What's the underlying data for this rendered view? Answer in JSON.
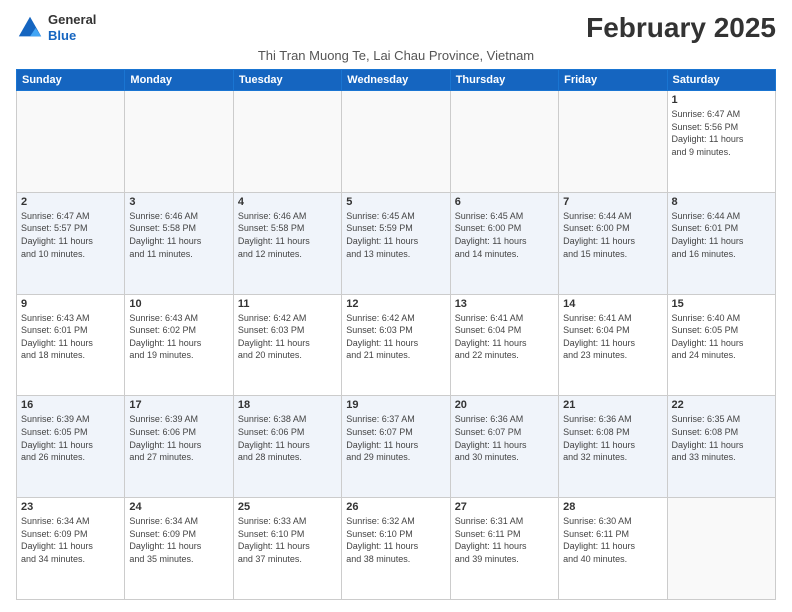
{
  "header": {
    "logo": {
      "general": "General",
      "blue": "Blue"
    },
    "title": "February 2025",
    "subtitle": "Thi Tran Muong Te, Lai Chau Province, Vietnam"
  },
  "days_of_week": [
    "Sunday",
    "Monday",
    "Tuesday",
    "Wednesday",
    "Thursday",
    "Friday",
    "Saturday"
  ],
  "weeks": [
    [
      {
        "day": "",
        "info": ""
      },
      {
        "day": "",
        "info": ""
      },
      {
        "day": "",
        "info": ""
      },
      {
        "day": "",
        "info": ""
      },
      {
        "day": "",
        "info": ""
      },
      {
        "day": "",
        "info": ""
      },
      {
        "day": "1",
        "info": "Sunrise: 6:47 AM\nSunset: 5:56 PM\nDaylight: 11 hours\nand 9 minutes."
      }
    ],
    [
      {
        "day": "2",
        "info": "Sunrise: 6:47 AM\nSunset: 5:57 PM\nDaylight: 11 hours\nand 10 minutes."
      },
      {
        "day": "3",
        "info": "Sunrise: 6:46 AM\nSunset: 5:58 PM\nDaylight: 11 hours\nand 11 minutes."
      },
      {
        "day": "4",
        "info": "Sunrise: 6:46 AM\nSunset: 5:58 PM\nDaylight: 11 hours\nand 12 minutes."
      },
      {
        "day": "5",
        "info": "Sunrise: 6:45 AM\nSunset: 5:59 PM\nDaylight: 11 hours\nand 13 minutes."
      },
      {
        "day": "6",
        "info": "Sunrise: 6:45 AM\nSunset: 6:00 PM\nDaylight: 11 hours\nand 14 minutes."
      },
      {
        "day": "7",
        "info": "Sunrise: 6:44 AM\nSunset: 6:00 PM\nDaylight: 11 hours\nand 15 minutes."
      },
      {
        "day": "8",
        "info": "Sunrise: 6:44 AM\nSunset: 6:01 PM\nDaylight: 11 hours\nand 16 minutes."
      }
    ],
    [
      {
        "day": "9",
        "info": "Sunrise: 6:43 AM\nSunset: 6:01 PM\nDaylight: 11 hours\nand 18 minutes."
      },
      {
        "day": "10",
        "info": "Sunrise: 6:43 AM\nSunset: 6:02 PM\nDaylight: 11 hours\nand 19 minutes."
      },
      {
        "day": "11",
        "info": "Sunrise: 6:42 AM\nSunset: 6:03 PM\nDaylight: 11 hours\nand 20 minutes."
      },
      {
        "day": "12",
        "info": "Sunrise: 6:42 AM\nSunset: 6:03 PM\nDaylight: 11 hours\nand 21 minutes."
      },
      {
        "day": "13",
        "info": "Sunrise: 6:41 AM\nSunset: 6:04 PM\nDaylight: 11 hours\nand 22 minutes."
      },
      {
        "day": "14",
        "info": "Sunrise: 6:41 AM\nSunset: 6:04 PM\nDaylight: 11 hours\nand 23 minutes."
      },
      {
        "day": "15",
        "info": "Sunrise: 6:40 AM\nSunset: 6:05 PM\nDaylight: 11 hours\nand 24 minutes."
      }
    ],
    [
      {
        "day": "16",
        "info": "Sunrise: 6:39 AM\nSunset: 6:05 PM\nDaylight: 11 hours\nand 26 minutes."
      },
      {
        "day": "17",
        "info": "Sunrise: 6:39 AM\nSunset: 6:06 PM\nDaylight: 11 hours\nand 27 minutes."
      },
      {
        "day": "18",
        "info": "Sunrise: 6:38 AM\nSunset: 6:06 PM\nDaylight: 11 hours\nand 28 minutes."
      },
      {
        "day": "19",
        "info": "Sunrise: 6:37 AM\nSunset: 6:07 PM\nDaylight: 11 hours\nand 29 minutes."
      },
      {
        "day": "20",
        "info": "Sunrise: 6:36 AM\nSunset: 6:07 PM\nDaylight: 11 hours\nand 30 minutes."
      },
      {
        "day": "21",
        "info": "Sunrise: 6:36 AM\nSunset: 6:08 PM\nDaylight: 11 hours\nand 32 minutes."
      },
      {
        "day": "22",
        "info": "Sunrise: 6:35 AM\nSunset: 6:08 PM\nDaylight: 11 hours\nand 33 minutes."
      }
    ],
    [
      {
        "day": "23",
        "info": "Sunrise: 6:34 AM\nSunset: 6:09 PM\nDaylight: 11 hours\nand 34 minutes."
      },
      {
        "day": "24",
        "info": "Sunrise: 6:34 AM\nSunset: 6:09 PM\nDaylight: 11 hours\nand 35 minutes."
      },
      {
        "day": "25",
        "info": "Sunrise: 6:33 AM\nSunset: 6:10 PM\nDaylight: 11 hours\nand 37 minutes."
      },
      {
        "day": "26",
        "info": "Sunrise: 6:32 AM\nSunset: 6:10 PM\nDaylight: 11 hours\nand 38 minutes."
      },
      {
        "day": "27",
        "info": "Sunrise: 6:31 AM\nSunset: 6:11 PM\nDaylight: 11 hours\nand 39 minutes."
      },
      {
        "day": "28",
        "info": "Sunrise: 6:30 AM\nSunset: 6:11 PM\nDaylight: 11 hours\nand 40 minutes."
      },
      {
        "day": "",
        "info": ""
      }
    ]
  ]
}
